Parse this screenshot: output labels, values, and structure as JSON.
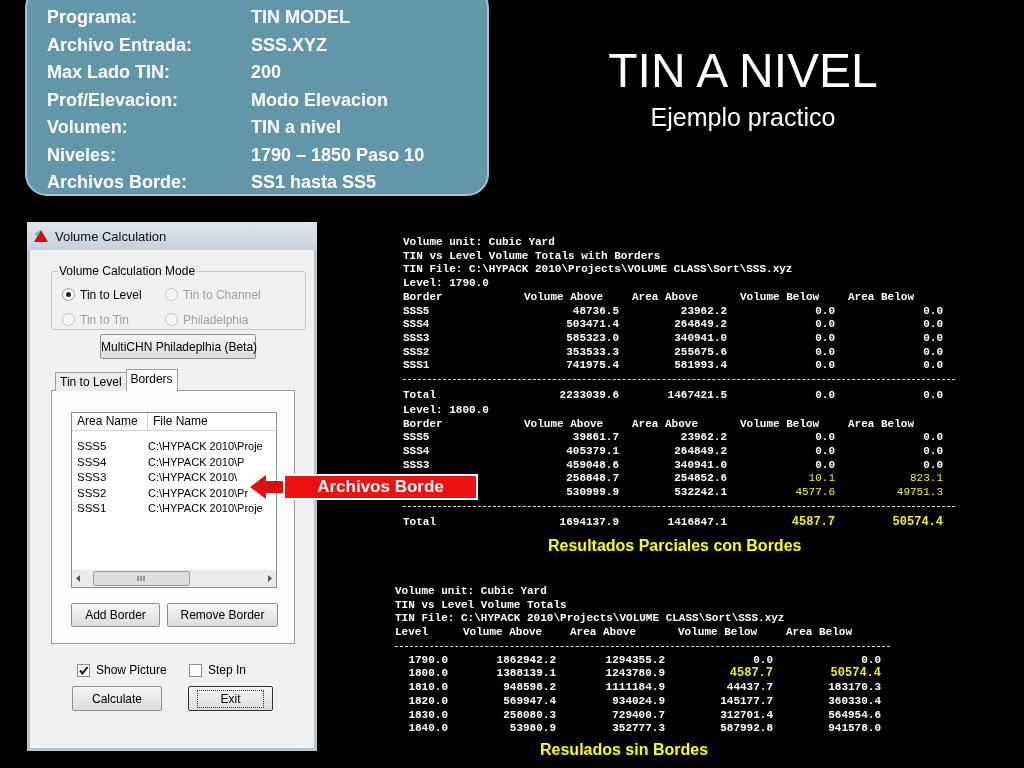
{
  "info_box": {
    "rows": [
      {
        "label": "Programa:",
        "value": "TIN MODEL"
      },
      {
        "label": "Archivo Entrada:",
        "value": "SSS.XYZ"
      },
      {
        "label": "Max Lado TIN:",
        "value": "200"
      },
      {
        "label": "Prof/Elevacion:",
        "value": "Modo Elevacion"
      },
      {
        "label": "Volumen:",
        "value": "TIN a nivel"
      },
      {
        "label": "Niveles:",
        "value": "1790 – 1850 Paso 10"
      },
      {
        "label": "Archivos Borde:",
        "value": "SS1 hasta SS5"
      }
    ]
  },
  "title": "TIN A NIVEL",
  "subtitle": "Ejemplo practico",
  "dialog": {
    "title": "Volume Calculation",
    "mode_group": {
      "label": "Volume Calculation  Mode",
      "options": [
        {
          "label": "Tin to Level",
          "selected": true,
          "disabled": false
        },
        {
          "label": "Tin to Channel",
          "selected": false,
          "disabled": true
        },
        {
          "label": "Tin to Tin",
          "selected": false,
          "disabled": true
        },
        {
          "label": "Philadelphia",
          "selected": false,
          "disabled": true
        }
      ]
    },
    "multichn_button": "MultiCHN Philadeplhia (Beta)",
    "tabs": [
      {
        "label": "Tin to Level",
        "selected": false
      },
      {
        "label": "Borders",
        "selected": true
      }
    ],
    "border_list": {
      "columns": [
        "Area Name",
        "File Name"
      ],
      "rows": [
        {
          "area": "SSS5",
          "file": "C:\\HYPACK 2010\\Proje"
        },
        {
          "area": "SSS4",
          "file": "C:\\HYPACK 2010\\P"
        },
        {
          "area": "SSS3",
          "file": "C:\\HYPACK 2010\\"
        },
        {
          "area": "SSS2",
          "file": "C:\\HYPACK 2010\\Pr"
        },
        {
          "area": "SSS1",
          "file": "C:\\HYPACK 2010\\Proje"
        }
      ]
    },
    "list_buttons": [
      "Add Border",
      "Remove Border"
    ],
    "checkboxes": [
      {
        "label": "Show Picture",
        "checked": true
      },
      {
        "label": "Step In",
        "checked": false
      }
    ],
    "buttons": [
      {
        "label": "Calculate",
        "focused": false
      },
      {
        "label": "Exit",
        "focused": true
      }
    ]
  },
  "callout": {
    "label": "Archivos Borde"
  },
  "bordered_output": {
    "lines": [
      "Volume unit: Cubic Yard",
      "TIN vs Level Volume Totals with Borders",
      "TIN File: C:\\HYPACK 2010\\Projects\\VOLUME CLASS\\Sort\\SSS.xyz"
    ],
    "levels": [
      {
        "level": "Level: 1790.0",
        "columns": [
          "Border",
          "Volume Above",
          "Area Above",
          "Volume Below",
          "Area Below"
        ],
        "rows": [
          {
            "border": "SSS5",
            "values": [
              "48736.5",
              "23962.2",
              "0.0",
              "0.0"
            ],
            "highlight": false
          },
          {
            "border": "SSS4",
            "values": [
              "503471.4",
              "264849.2",
              "0.0",
              "0.0"
            ],
            "highlight": false
          },
          {
            "border": "SSS3",
            "values": [
              "585323.0",
              "340941.0",
              "0.0",
              "0.0"
            ],
            "highlight": false
          },
          {
            "border": "SSS2",
            "values": [
              "353533.3",
              "255675.6",
              "0.0",
              "0.0"
            ],
            "highlight": false
          },
          {
            "border": "SSS1",
            "values": [
              "741975.4",
              "581993.4",
              "0.0",
              "0.0"
            ],
            "highlight": false
          }
        ],
        "total": {
          "label": "Total",
          "values": [
            "2233039.6",
            "1467421.5",
            "0.0",
            "0.0"
          ],
          "highlight": false
        }
      },
      {
        "level": "Level: 1800.0",
        "columns": [
          "Border",
          "Volume Above",
          "Area Above",
          "Volume Below",
          "Area Below"
        ],
        "rows": [
          {
            "border": "SSS5",
            "values": [
              "39861.7",
              "23962.2",
              "0.0",
              "0.0"
            ],
            "highlight": false
          },
          {
            "border": "SSS4",
            "values": [
              "405379.1",
              "264849.2",
              "0.0",
              "0.0"
            ],
            "highlight": false
          },
          {
            "border": "SSS3",
            "values": [
              "459048.6",
              "340941.0",
              "0.0",
              "0.0"
            ],
            "highlight": false
          },
          {
            "values": [
              "258848.7",
              "254852.6",
              "10.1",
              "823.1"
            ],
            "highlight": true
          },
          {
            "values": [
              "530999.9",
              "532242.1",
              "4577.6",
              "49751.3"
            ],
            "highlight": true
          }
        ],
        "total": {
          "label": "Total",
          "values": [
            "1694137.9",
            "1416847.1",
            "4587.7",
            "50574.4"
          ],
          "highlight": true
        }
      }
    ]
  },
  "bordered_caption": "Resultados Parciales con Bordes",
  "plain_output": {
    "lines": [
      "Volume unit: Cubic Yard",
      "TIN vs Level Volume Totals",
      "TIN File: C:\\HYPACK 2010\\Projects\\VOLUME CLASS\\Sort\\SSS.xyz"
    ],
    "columns": [
      "Level",
      "Volume Above",
      "Area Above",
      "Volume Below",
      "Area Below"
    ],
    "rows": [
      {
        "values": [
          "1790.0",
          "1862942.2",
          "1294355.2",
          "0.0",
          "0.0"
        ],
        "highlight": false
      },
      {
        "values": [
          "1800.0",
          "1388139.1",
          "1243780.9",
          "4587.7",
          "50574.4"
        ],
        "highlight": true
      },
      {
        "values": [
          "1810.0",
          "948598.2",
          "1111184.9",
          "44437.7",
          "183170.3"
        ],
        "highlight": false
      },
      {
        "values": [
          "1820.0",
          "569947.4",
          "934024.9",
          "145177.7",
          "360330.4"
        ],
        "highlight": false
      },
      {
        "values": [
          "1830.0",
          "258080.3",
          "729400.7",
          "312701.4",
          "564954.6"
        ],
        "highlight": false
      },
      {
        "values": [
          "1840.0",
          "53980.9",
          "352777.3",
          "587992.8",
          "941578.0"
        ],
        "highlight": false
      }
    ]
  },
  "plain_caption": "Resulados sin Bordes"
}
